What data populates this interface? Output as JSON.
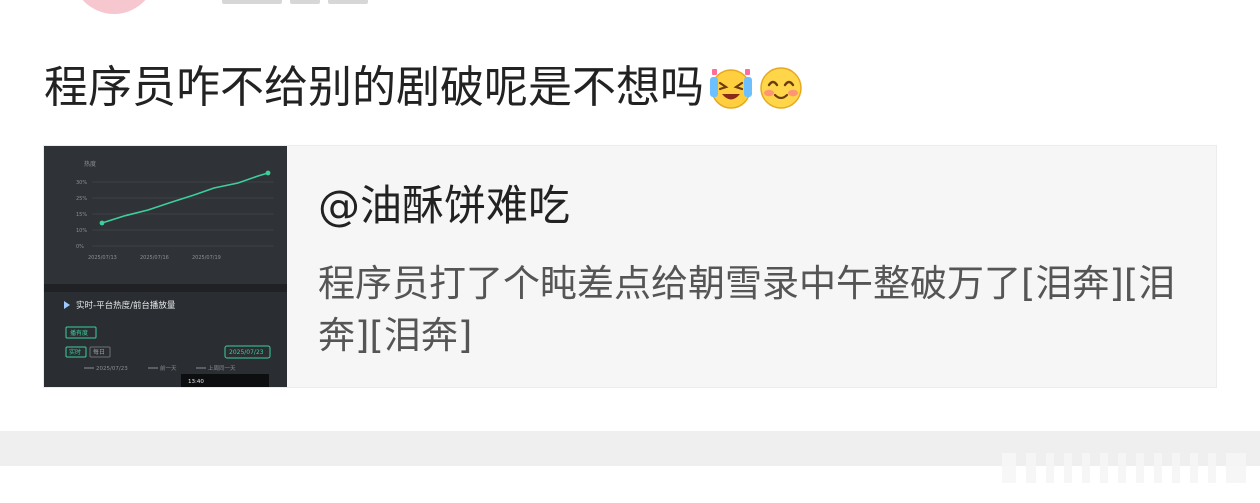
{
  "post": {
    "text": "程序员咋不给别的剧破呢是不想吗",
    "emojis": [
      "laugh-cry-emoji",
      "blush-emoji"
    ]
  },
  "shared_card": {
    "author": "@油酥饼难吃",
    "body": "程序员打了个盹差点给朝雪录中午整破万了[泪奔][泪奔][泪奔]",
    "thumbnail": {
      "panel_title": "实时-平台热度/前台播放量",
      "tags": [
        "播有度",
        "实时",
        "每日"
      ],
      "date_badge": "2025/07/23",
      "legend": [
        "2025/07/23",
        "前一天",
        "上周同一天"
      ],
      "time_label": "13:40",
      "chart_dates": [
        "2025/07/13",
        "2025/07/16",
        "2025/07/19"
      ]
    }
  },
  "colors": {
    "text_main": "#222222",
    "text_secondary": "#555555",
    "card_bg": "#f6f6f6",
    "thumb_bg": "#2a2d31",
    "accent_green": "#3ccf9a"
  }
}
